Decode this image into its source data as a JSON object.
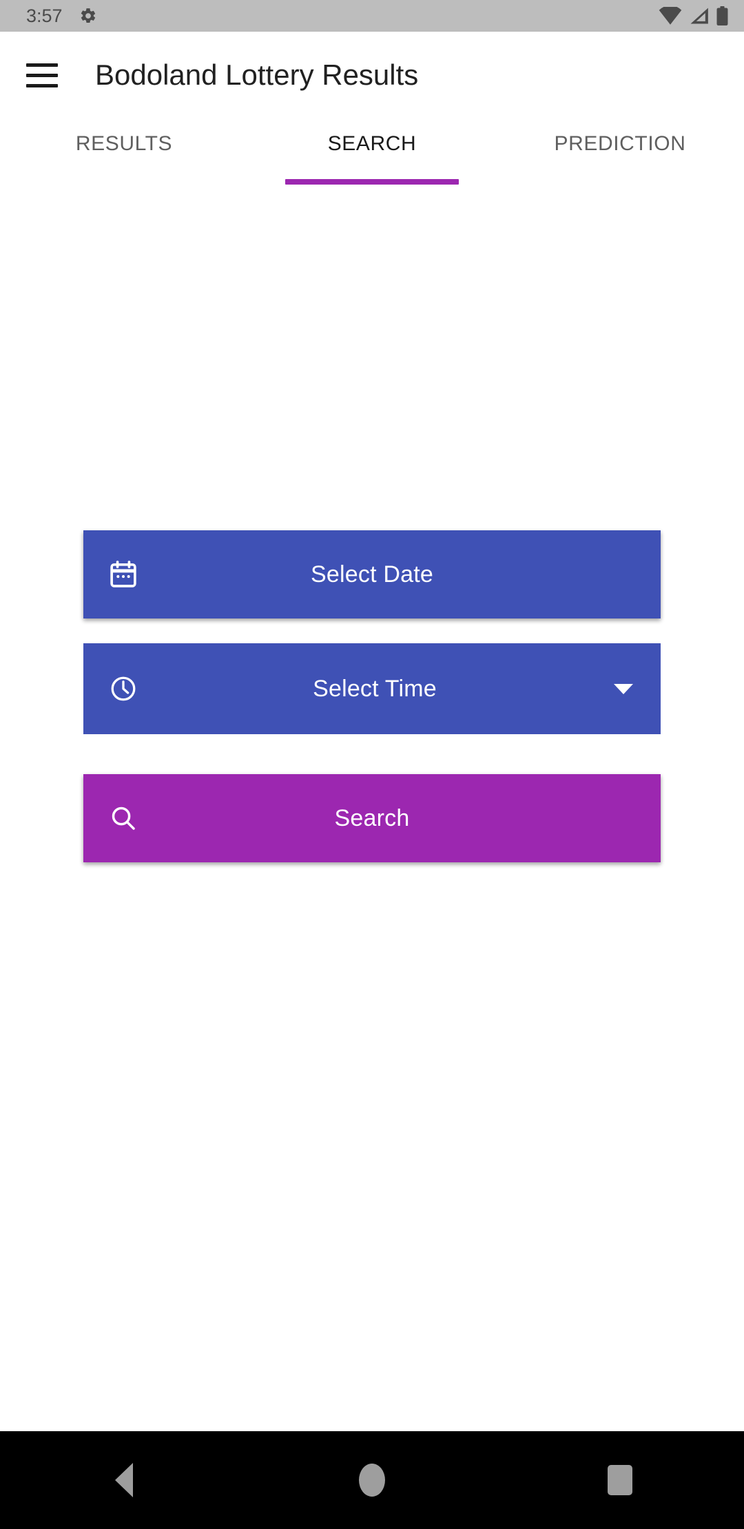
{
  "status_bar": {
    "time": "3:57",
    "icons": {
      "settings": "gear-icon",
      "wifi": "wifi-icon",
      "signal": "signal-icon",
      "battery": "battery-icon"
    },
    "background_color": "#bdbdbd"
  },
  "app_bar": {
    "menu_icon": "hamburger-menu-icon",
    "title": "Bodoland Lottery Results"
  },
  "tabs": {
    "active_index": 1,
    "indicator_color": "#9c27b0",
    "items": [
      {
        "label": "RESULTS"
      },
      {
        "label": "SEARCH"
      },
      {
        "label": "PREDICTION"
      }
    ]
  },
  "search_form": {
    "select_date": {
      "label": "Select Date",
      "icon": "calendar-icon",
      "color": "#3f51b5"
    },
    "select_time": {
      "label": "Select Time",
      "icon": "clock-icon",
      "caret": "chevron-down-icon",
      "color": "#3f51b5"
    },
    "search": {
      "label": "Search",
      "icon": "search-icon",
      "color": "#9c27b0"
    }
  },
  "nav_bar": {
    "back": "back-triangle-icon",
    "home": "home-circle-icon",
    "recents": "recents-square-icon",
    "background_color": "#000000"
  }
}
